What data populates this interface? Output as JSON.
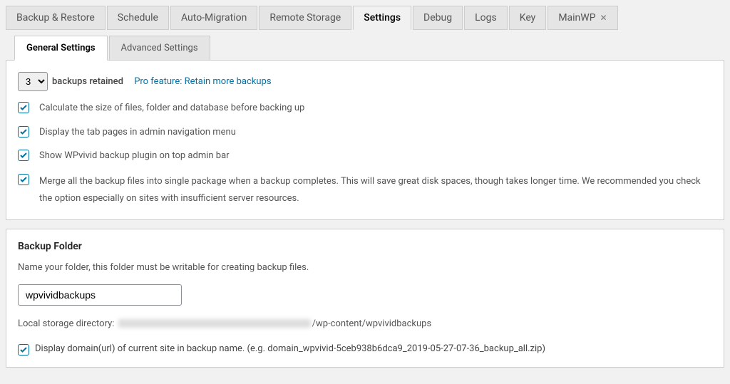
{
  "topTabs": {
    "backupRestore": "Backup & Restore",
    "schedule": "Schedule",
    "autoMigration": "Auto-Migration",
    "remoteStorage": "Remote Storage",
    "settings": "Settings",
    "debug": "Debug",
    "logs": "Logs",
    "key": "Key",
    "mainwp": "MainWP"
  },
  "subTabs": {
    "general": "General Settings",
    "advanced": "Advanced Settings"
  },
  "settings": {
    "retainedValue": "3",
    "retainedLabel": "backups retained",
    "proLink": "Pro feature: Retain more backups",
    "calcSize": "Calculate the size of files, folder and database before backing up",
    "displayTabs": "Display the tab pages in admin navigation menu",
    "showTopBar": "Show WPvivid backup plugin on top admin bar",
    "mergeFiles": "Merge all the backup files into single package when a backup completes. This will save great disk spaces, though takes longer time. We recommended you check the option especially on sites with insufficient server resources."
  },
  "backupFolder": {
    "heading": "Backup Folder",
    "desc": "Name your folder, this folder must be writable for creating backup files.",
    "value": "wpvividbackups",
    "storageLabel": "Local storage directory:",
    "storagePath": "/wp-content/wpvividbackups",
    "displayDomain": "Display domain(url) of current site in backup name. (e.g. domain_wpvivid-5ceb938b6dca9_2019-05-27-07-36_backup_all.zip)"
  }
}
